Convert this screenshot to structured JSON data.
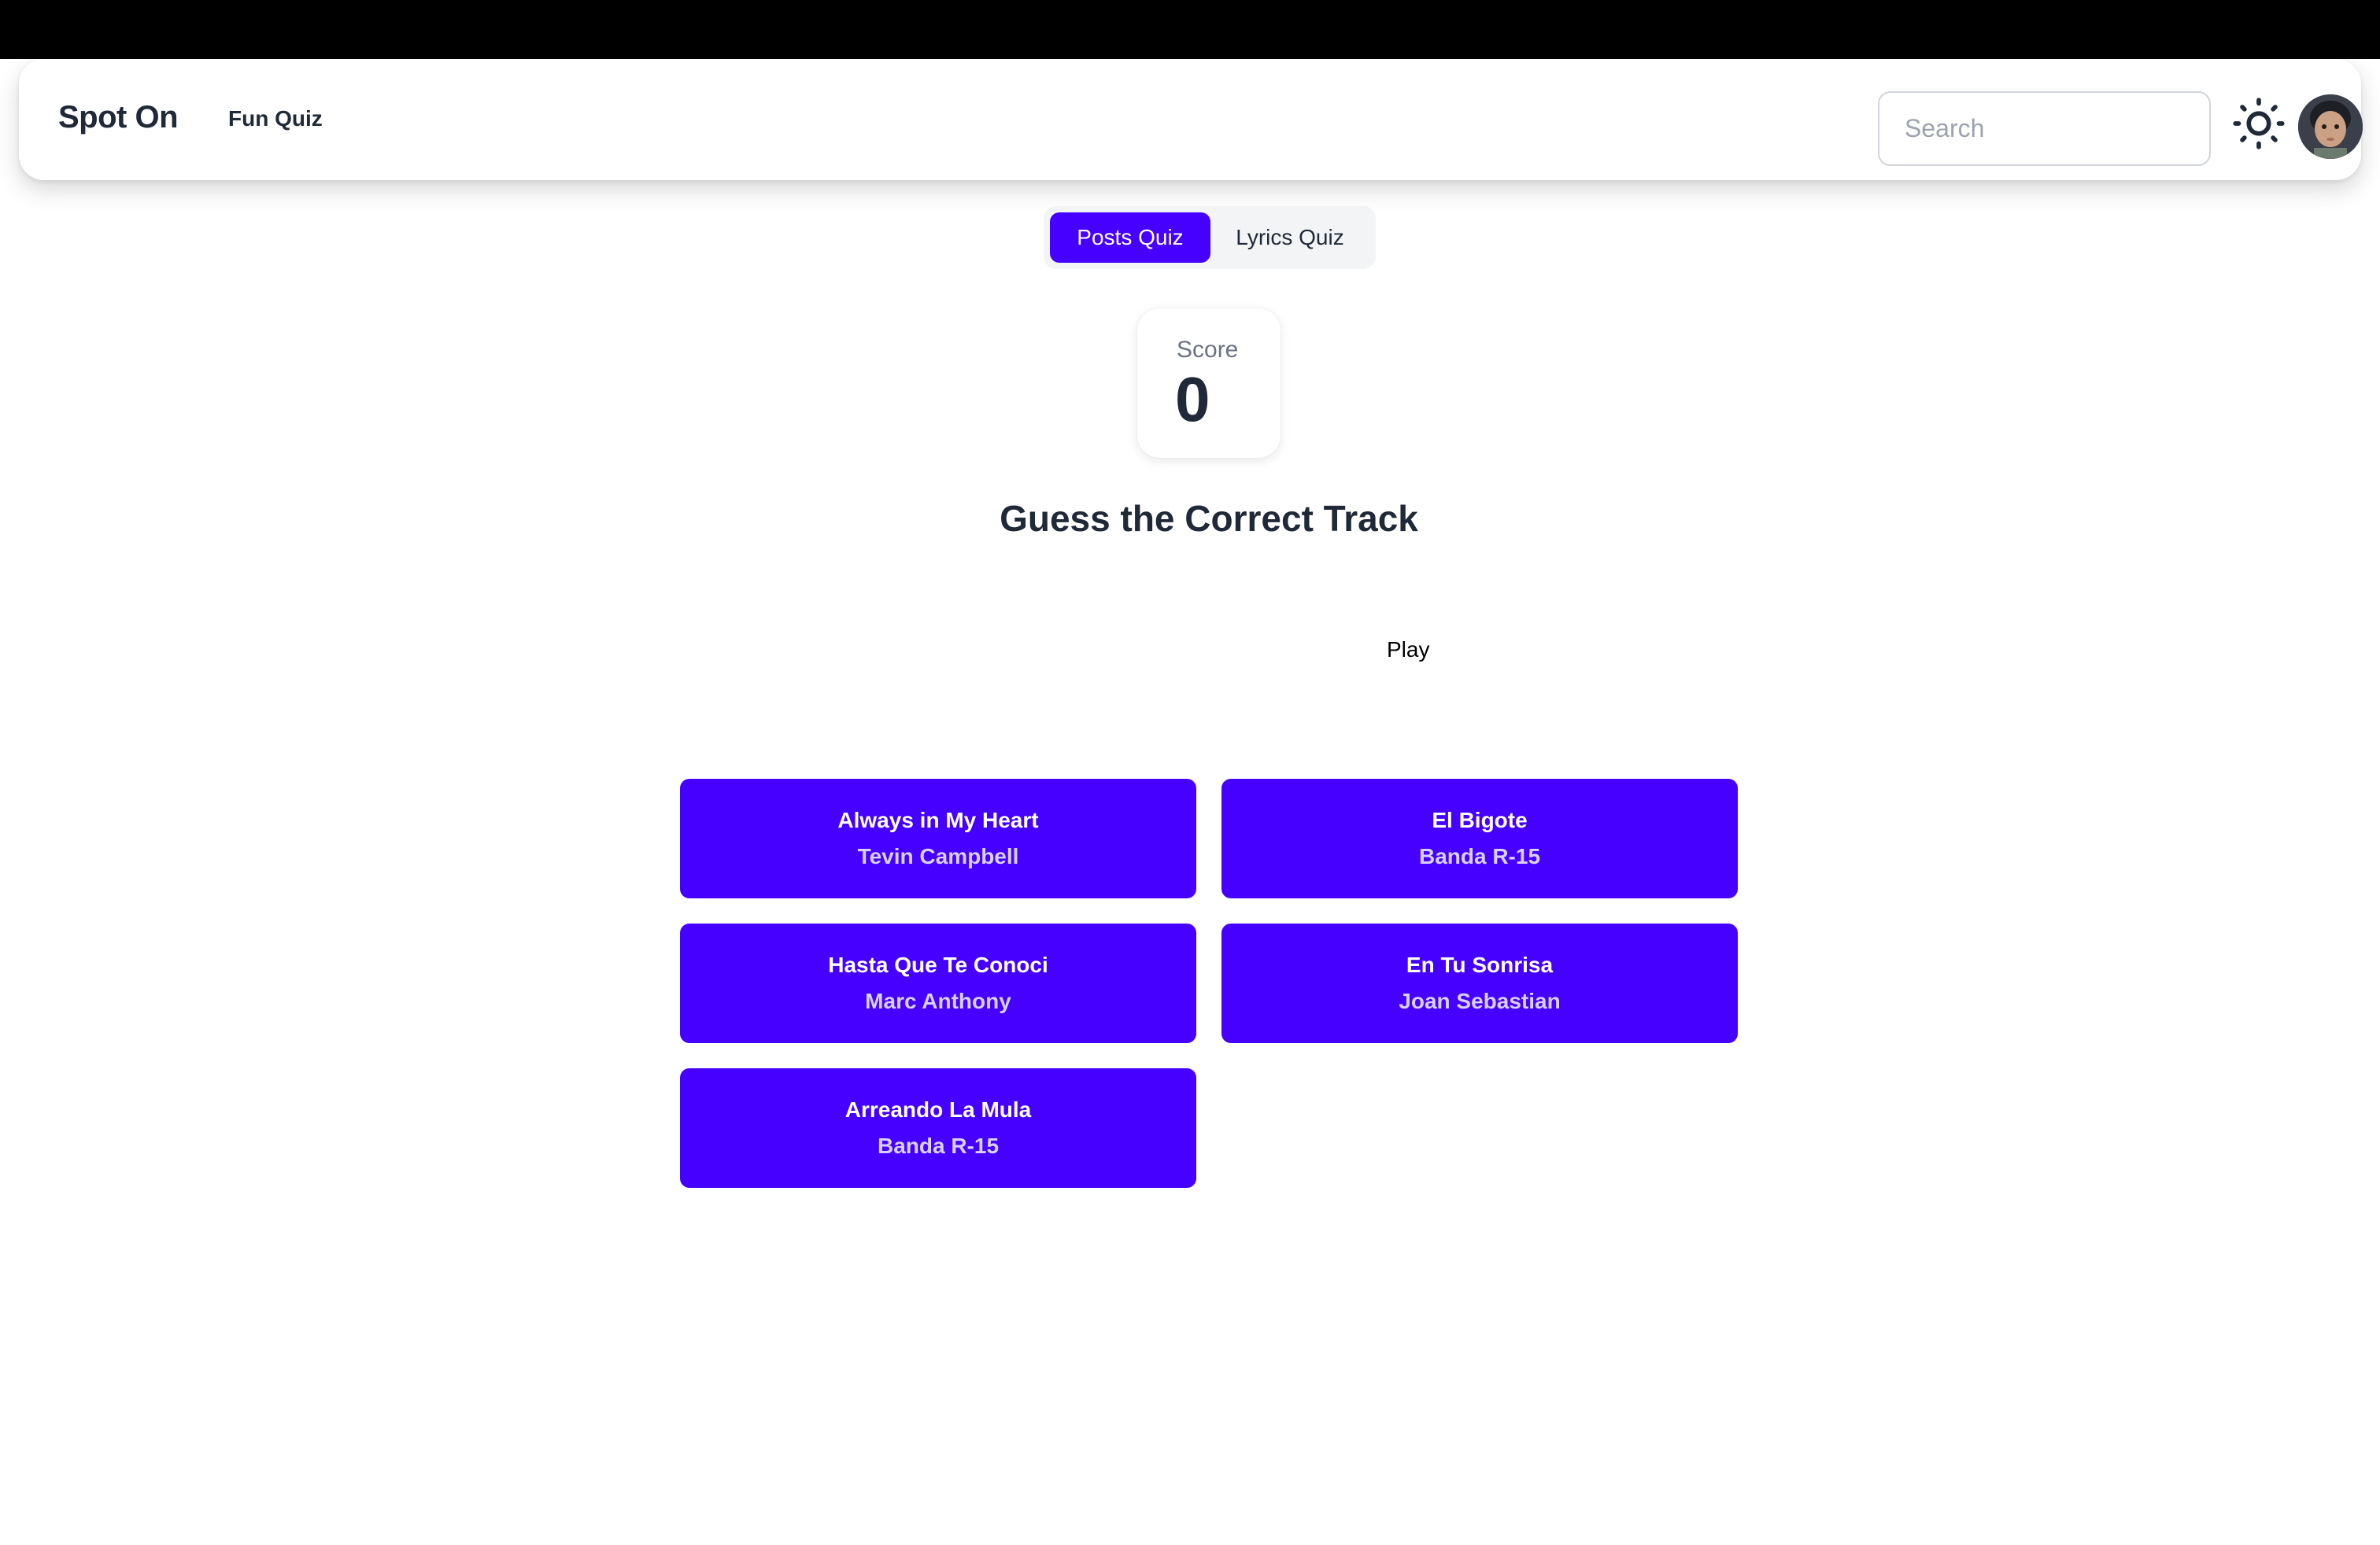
{
  "navbar": {
    "brand": "Spot On",
    "link": "Fun Quiz",
    "search_placeholder": "Search",
    "theme_icon": "sun-icon"
  },
  "tabs": [
    {
      "label": "Posts Quiz",
      "active": true
    },
    {
      "label": "Lyrics Quiz",
      "active": false
    }
  ],
  "score": {
    "label": "Score",
    "value": "0"
  },
  "quiz": {
    "heading": "Guess the Correct Track",
    "play_label": "Play",
    "answers": [
      {
        "title": "Always in My Heart",
        "artist": "Tevin Campbell"
      },
      {
        "title": "El Bigote",
        "artist": "Banda R-15"
      },
      {
        "title": "Hasta Que Te Conoci",
        "artist": "Marc Anthony"
      },
      {
        "title": "En Tu Sonrisa",
        "artist": "Joan Sebastian"
      },
      {
        "title": "Arreando La Mula",
        "artist": "Banda R-15"
      }
    ]
  },
  "colors": {
    "accent": "#4500ff",
    "text": "#1f2937"
  }
}
